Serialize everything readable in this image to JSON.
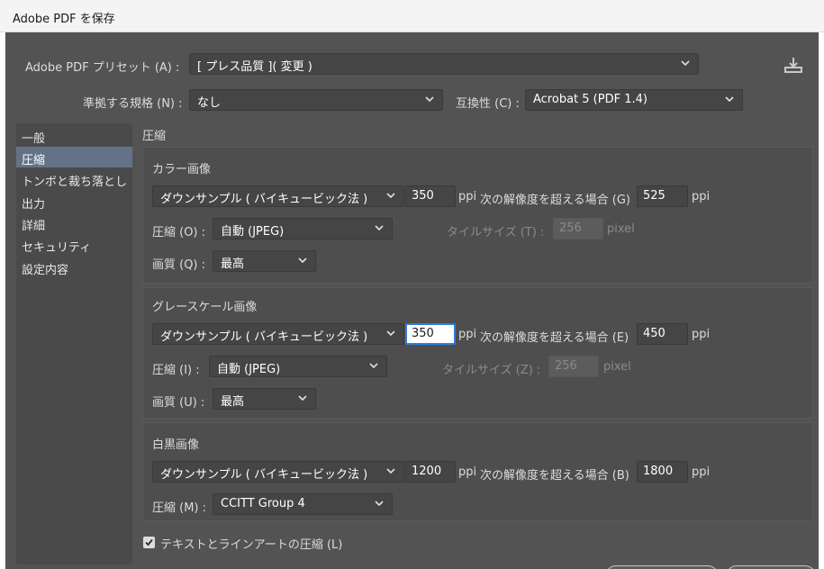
{
  "window": {
    "title": "Adobe PDF を保存"
  },
  "preset": {
    "label": "Adobe PDF プリセット (A) :",
    "value": "[ プレス品質 ]( 変更 )"
  },
  "standard": {
    "label": "準拠する規格 (N) :",
    "value": "なし"
  },
  "compat": {
    "label": "互換性 (C) :",
    "value": "Acrobat 5 (PDF 1.4)"
  },
  "sidebar": {
    "items": [
      {
        "label": "一般"
      },
      {
        "label": "圧縮"
      },
      {
        "label": "トンボと裁ち落とし"
      },
      {
        "label": "出力"
      },
      {
        "label": "詳細"
      },
      {
        "label": "セキュリティ"
      },
      {
        "label": "設定内容"
      }
    ],
    "selected": "圧縮"
  },
  "main": {
    "heading": "圧縮"
  },
  "color": {
    "heading": "カラー画像",
    "downsample": "ダウンサンプル ( バイキュービック法 )",
    "ppi": "350",
    "ppi_unit": "ppi",
    "threshold_label": "次の解像度を超える場合 (G)",
    "threshold": "525",
    "threshold_unit": "ppi",
    "compression_label": "圧縮 (O) :",
    "compression": "自動 (JPEG)",
    "tile_label": "タイルサイズ (T) :",
    "tile": "256",
    "tile_unit": "pixel",
    "quality_label": "画質 (Q) :",
    "quality": "最高"
  },
  "gray": {
    "heading": "グレースケール画像",
    "downsample": "ダウンサンプル ( バイキュービック法 )",
    "ppi": "350",
    "ppi_unit": "ppi",
    "threshold_label": "次の解像度を超える場合 (E)",
    "threshold": "450",
    "threshold_unit": "ppi",
    "compression_label": "圧縮 (I) :",
    "compression": "自動 (JPEG)",
    "tile_label": "タイルサイズ (Z) :",
    "tile": "256",
    "tile_unit": "pixel",
    "quality_label": "画質 (U) :",
    "quality": "最高"
  },
  "mono": {
    "heading": "白黒画像",
    "downsample": "ダウンサンプル ( バイキュービック法 )",
    "ppi": "1200",
    "ppi_unit": "ppi",
    "threshold_label": "次の解像度を超える場合 (B)",
    "threshold": "1800",
    "threshold_unit": "ppi",
    "compression_label": "圧縮 (M) :",
    "compression": "CCITT Group 4"
  },
  "text_art": {
    "label": "テキストとラインアートの圧縮 (L)",
    "checked": true
  },
  "icons": {
    "download": "download-icon",
    "chevron": "chevron-down-icon",
    "check": "check-icon"
  },
  "colors": {
    "dialog_bg": "#535353",
    "panel_bg": "#4e4e4e",
    "sidebar_bg": "#4a4a4a",
    "selected_item": "#647287",
    "field_bg": "#454545",
    "focus_border": "#2e7de0"
  }
}
